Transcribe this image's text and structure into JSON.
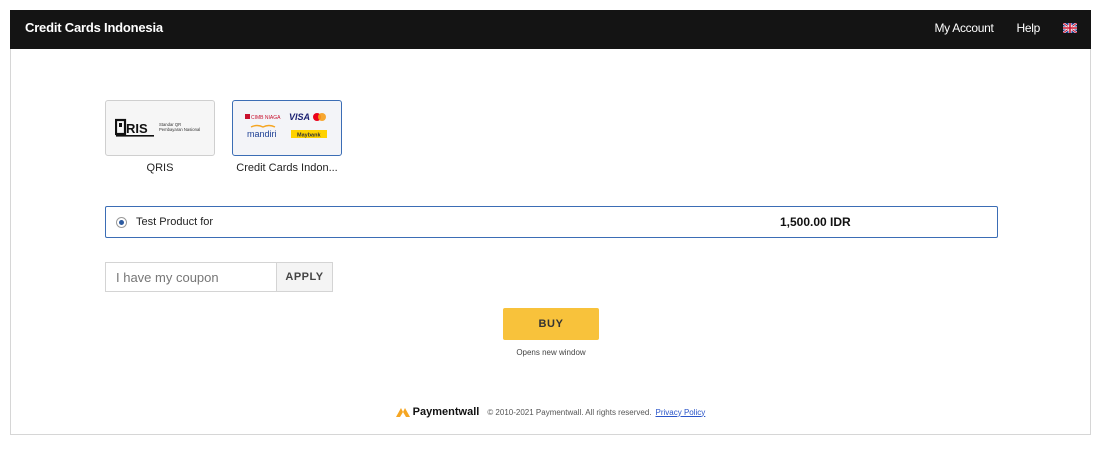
{
  "header": {
    "title": "Credit Cards Indonesia",
    "nav": {
      "account_label": "My Account",
      "help_label": "Help"
    },
    "flag_icon": "uk-flag-icon"
  },
  "payment_methods": [
    {
      "label": "QRIS",
      "logo_text": "QRIS",
      "logo_sub1": "Standar QR",
      "logo_sub2": "Pembayaran Nasional",
      "selected": false
    },
    {
      "label": "Credit Cards Indon...",
      "logos": [
        "CIMB NIAGA",
        "VISA",
        "mastercard",
        "mandiri",
        "Maybank"
      ],
      "selected": true
    }
  ],
  "product": {
    "name": "Test Product for",
    "price": "1,500.00 IDR",
    "selected": true
  },
  "coupon": {
    "placeholder": "I have my coupon",
    "value": "",
    "apply_label": "APPLY"
  },
  "buy": {
    "label": "BUY",
    "note": "Opens new window"
  },
  "footer": {
    "brand": "Paymentwall",
    "copyright": "© 2010-2021 Paymentwall. All rights reserved.",
    "privacy_label": "Privacy Policy"
  },
  "colors": {
    "topbar": "#141414",
    "accent": "#3b6db5",
    "buy": "#f8c23b",
    "link": "#2a55c9"
  }
}
